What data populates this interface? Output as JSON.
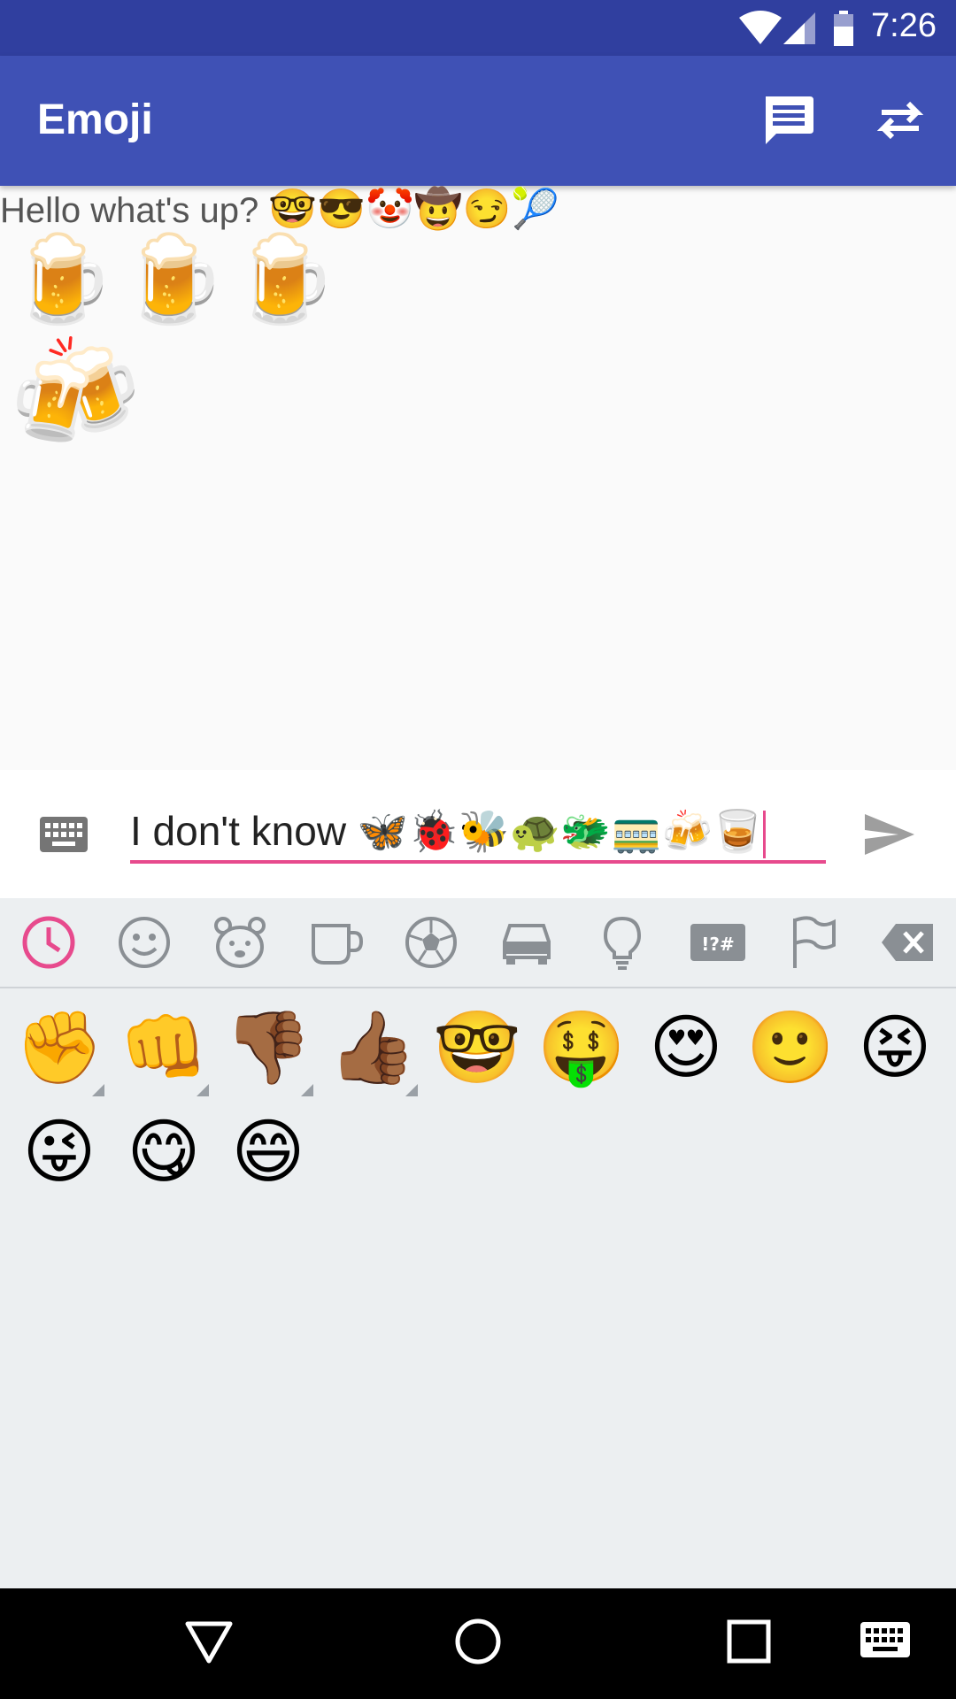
{
  "status_bar": {
    "time": "7:26",
    "icons": [
      "wifi-icon",
      "signal-icon",
      "battery-icon"
    ]
  },
  "app_bar": {
    "title": "Emoji",
    "actions": [
      "chat-icon",
      "swap-icon"
    ]
  },
  "messages": {
    "line1_text": "Hello what's up?",
    "line1_emoji": "🤓😎🤡🤠😏🎾",
    "line2": "🍺🍺🍺",
    "line3": "🍻"
  },
  "input": {
    "text": "I don't know 🦋🐞🐝🐢🐲🚃🍻🥃"
  },
  "emoji_categories": [
    "recent-icon",
    "smileys-icon",
    "animals-icon",
    "food-icon",
    "activity-icon",
    "travel-icon",
    "objects-icon",
    "symbols-icon",
    "flags-icon",
    "backspace-icon"
  ],
  "recent_emojis": [
    "✊",
    "👊",
    "👎🏾",
    "👍🏾",
    "🤓",
    "🤑",
    "😍",
    "🙂",
    "😝",
    "😜",
    "😋",
    "😄"
  ],
  "colors": {
    "primary": "#3f51b5",
    "primary_dark": "#303f9f",
    "accent": "#e74a8d"
  }
}
